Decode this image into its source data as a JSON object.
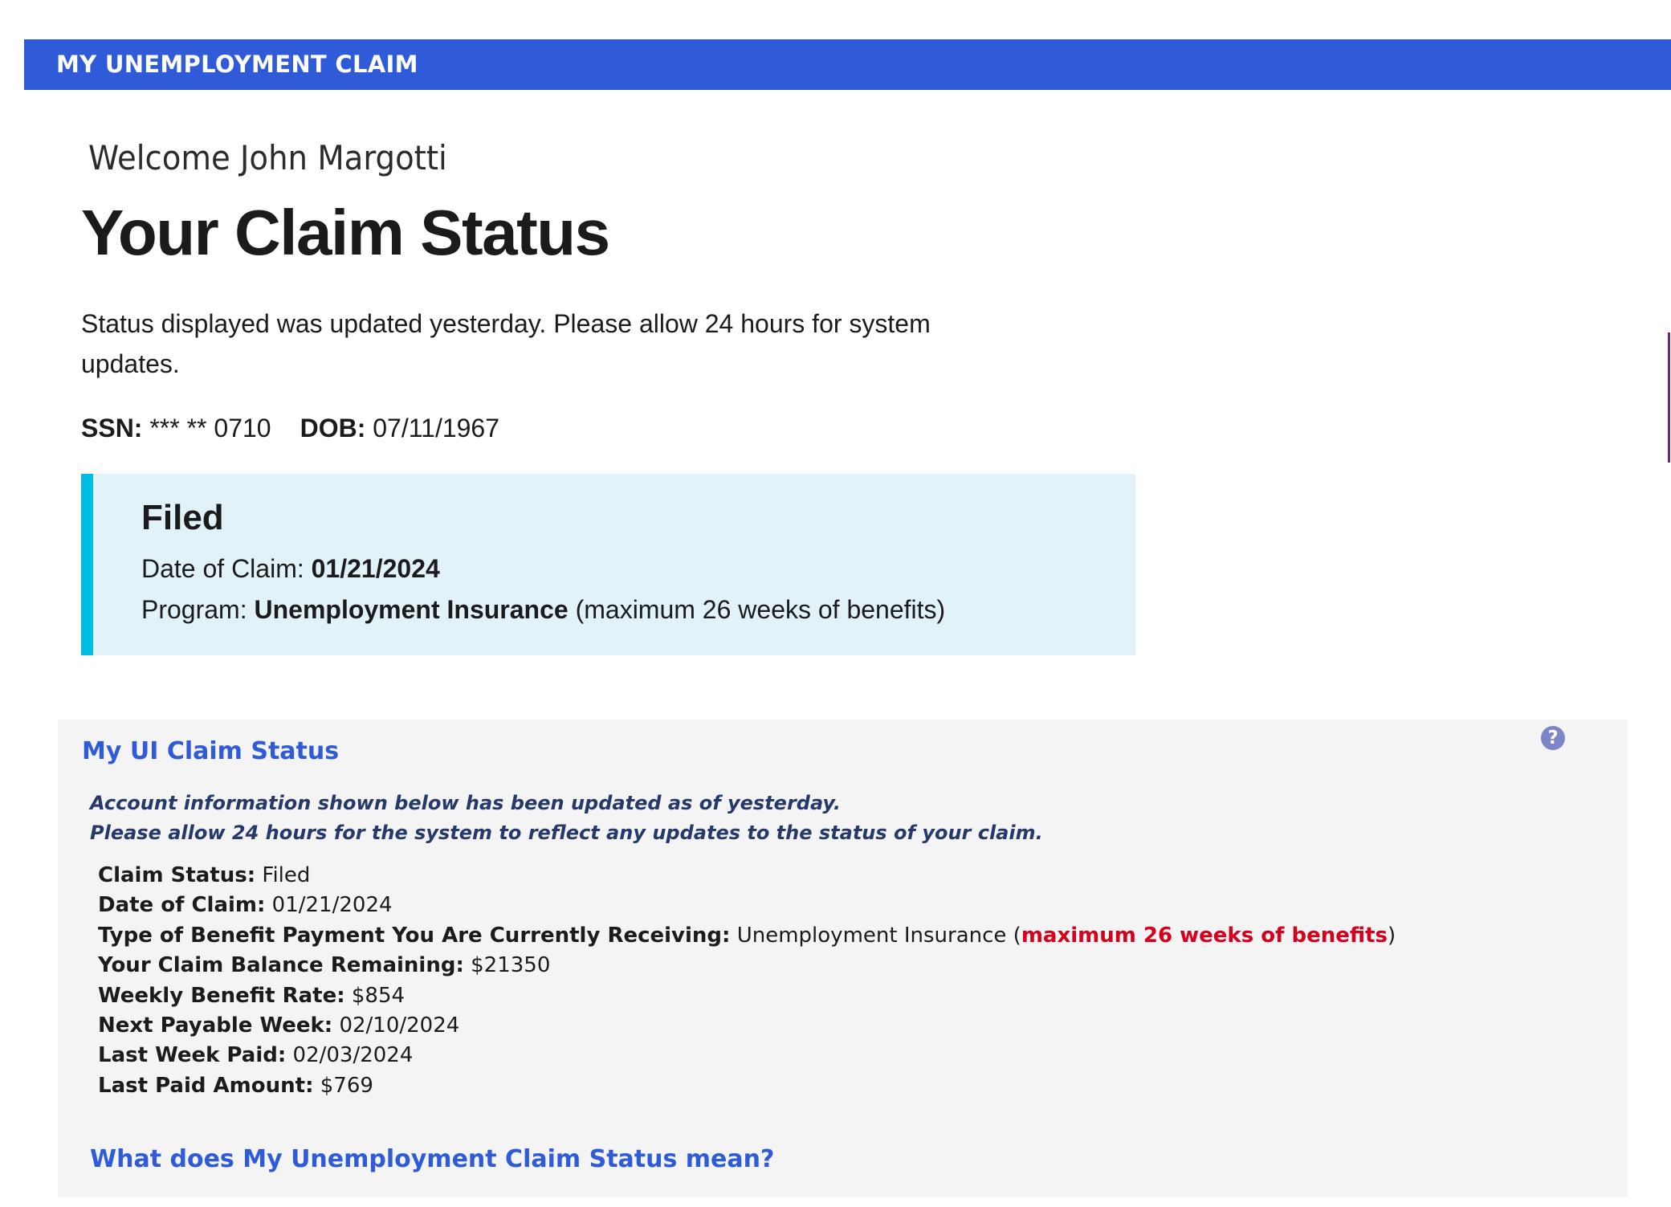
{
  "header": {
    "banner_title": "MY UNEMPLOYMENT CLAIM",
    "banner_color": "#2f5bd9"
  },
  "intro": {
    "welcome": "Welcome John Margotti",
    "page_title": "Your Claim Status",
    "status_note": "Status displayed was updated yesterday. Please allow 24 hours for system updates.",
    "ssn_label": "SSN:",
    "ssn_value": "*** ** 0710",
    "dob_label": "DOB:",
    "dob_value": "07/11/1967"
  },
  "filed_summary": {
    "heading": "Filed",
    "date_label": "Date of Claim:",
    "date_value": "01/21/2024",
    "program_label": "Program:",
    "program_value": "Unemployment Insurance",
    "program_note": "(maximum 26 weeks of benefits)",
    "accent_color": "#00bde3",
    "background_color": "#e1f3f8"
  },
  "ui_claim_panel": {
    "title": "My UI Claim Status",
    "help_icon": "question-circle-icon",
    "help_glyph": "?",
    "notice_line_1": "Account information shown below has been updated as of yesterday.",
    "notice_line_2": "Please allow 24 hours for the system to reflect any updates to the status of your claim.",
    "details": {
      "claim_status_label": "Claim Status:",
      "claim_status_value": "Filed",
      "date_of_claim_label": "Date of Claim:",
      "date_of_claim_value": "01/21/2024",
      "benefit_type_label": "Type of Benefit Payment You Are Currently Receiving:",
      "benefit_type_value": "Unemployment Insurance",
      "benefit_type_open": "(",
      "benefit_type_highlight": "maximum 26 weeks of benefits",
      "benefit_type_close": ")",
      "balance_label": "Your Claim Balance Remaining:",
      "balance_value": "$21350",
      "weekly_rate_label": "Weekly Benefit Rate:",
      "weekly_rate_value": "$854",
      "next_week_label": "Next Payable Week:",
      "next_week_value": "02/10/2024",
      "last_week_label": "Last Week Paid:",
      "last_week_value": "02/03/2024",
      "last_amount_label": "Last Paid Amount:",
      "last_amount_value": "$769"
    },
    "footer_link": "What does My Unemployment Claim Status mean?",
    "highlight_color": "#d6001c",
    "link_color": "#2f5bd9"
  }
}
